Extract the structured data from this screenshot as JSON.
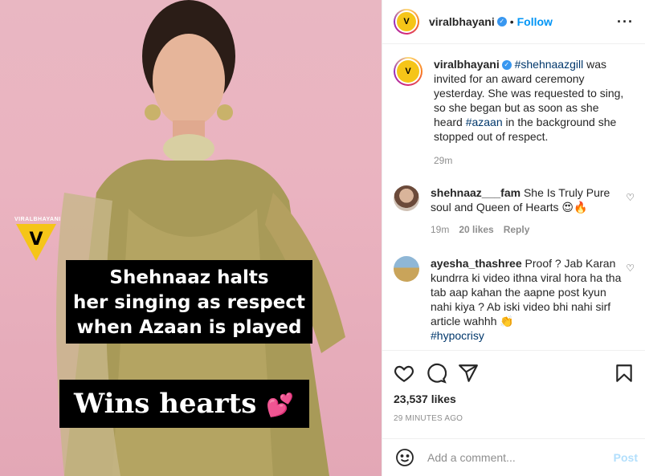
{
  "post": {
    "author": "viralbhayani",
    "follow_label": "Follow",
    "dot": "•",
    "more_icon": "more-options-icon",
    "verified_icon": "verified-badge-icon",
    "avatar_text": "V"
  },
  "media": {
    "watermark_text": "VIRALBHAYANI",
    "logo_letter": "V",
    "caption_lines": [
      "Shehnaaz halts",
      "her singing as respect",
      "when Azaan is played"
    ],
    "caption2": "Wins hearts",
    "caption2_emoji": "💕",
    "colors": {
      "background": "#e9b7c2",
      "dress": "#a89a58",
      "caption_bg": "#000000",
      "logo": "#f5c518"
    }
  },
  "caption": {
    "username": "viralbhayani",
    "tag1": "#shehnaazgill",
    "text1": " was invited for an award ceremony yesterday. She was requested to sing, so she began but as soon as she heard ",
    "tag2": "#azaan",
    "text2": " in the background she stopped out of respect.",
    "time": "29m"
  },
  "comments": [
    {
      "username": "shehnaaz___fam",
      "text": " She Is Truly Pure soul and Queen of Hearts 😍🔥",
      "time": "19m",
      "likes": "20 likes",
      "reply": "Reply"
    },
    {
      "username": "ayesha_thashree",
      "text": " Proof ? Jab Karan kundrra ki video ithna viral hora ha tha tab aap kahan the aapne post kyun nahi kiya ? Ab iski video bhi nahi sirf article wahhh 👏",
      "tag": "#hypocrisy"
    }
  ],
  "actions": {
    "likes": "23,537 likes",
    "timestamp": "29 minutes ago"
  },
  "add_comment": {
    "placeholder": "Add a comment...",
    "post_label": "Post"
  },
  "colors": {
    "link": "#00376b",
    "follow": "#0095f6",
    "muted": "#8e8e8e",
    "post_disabled": "#b2dffc"
  }
}
